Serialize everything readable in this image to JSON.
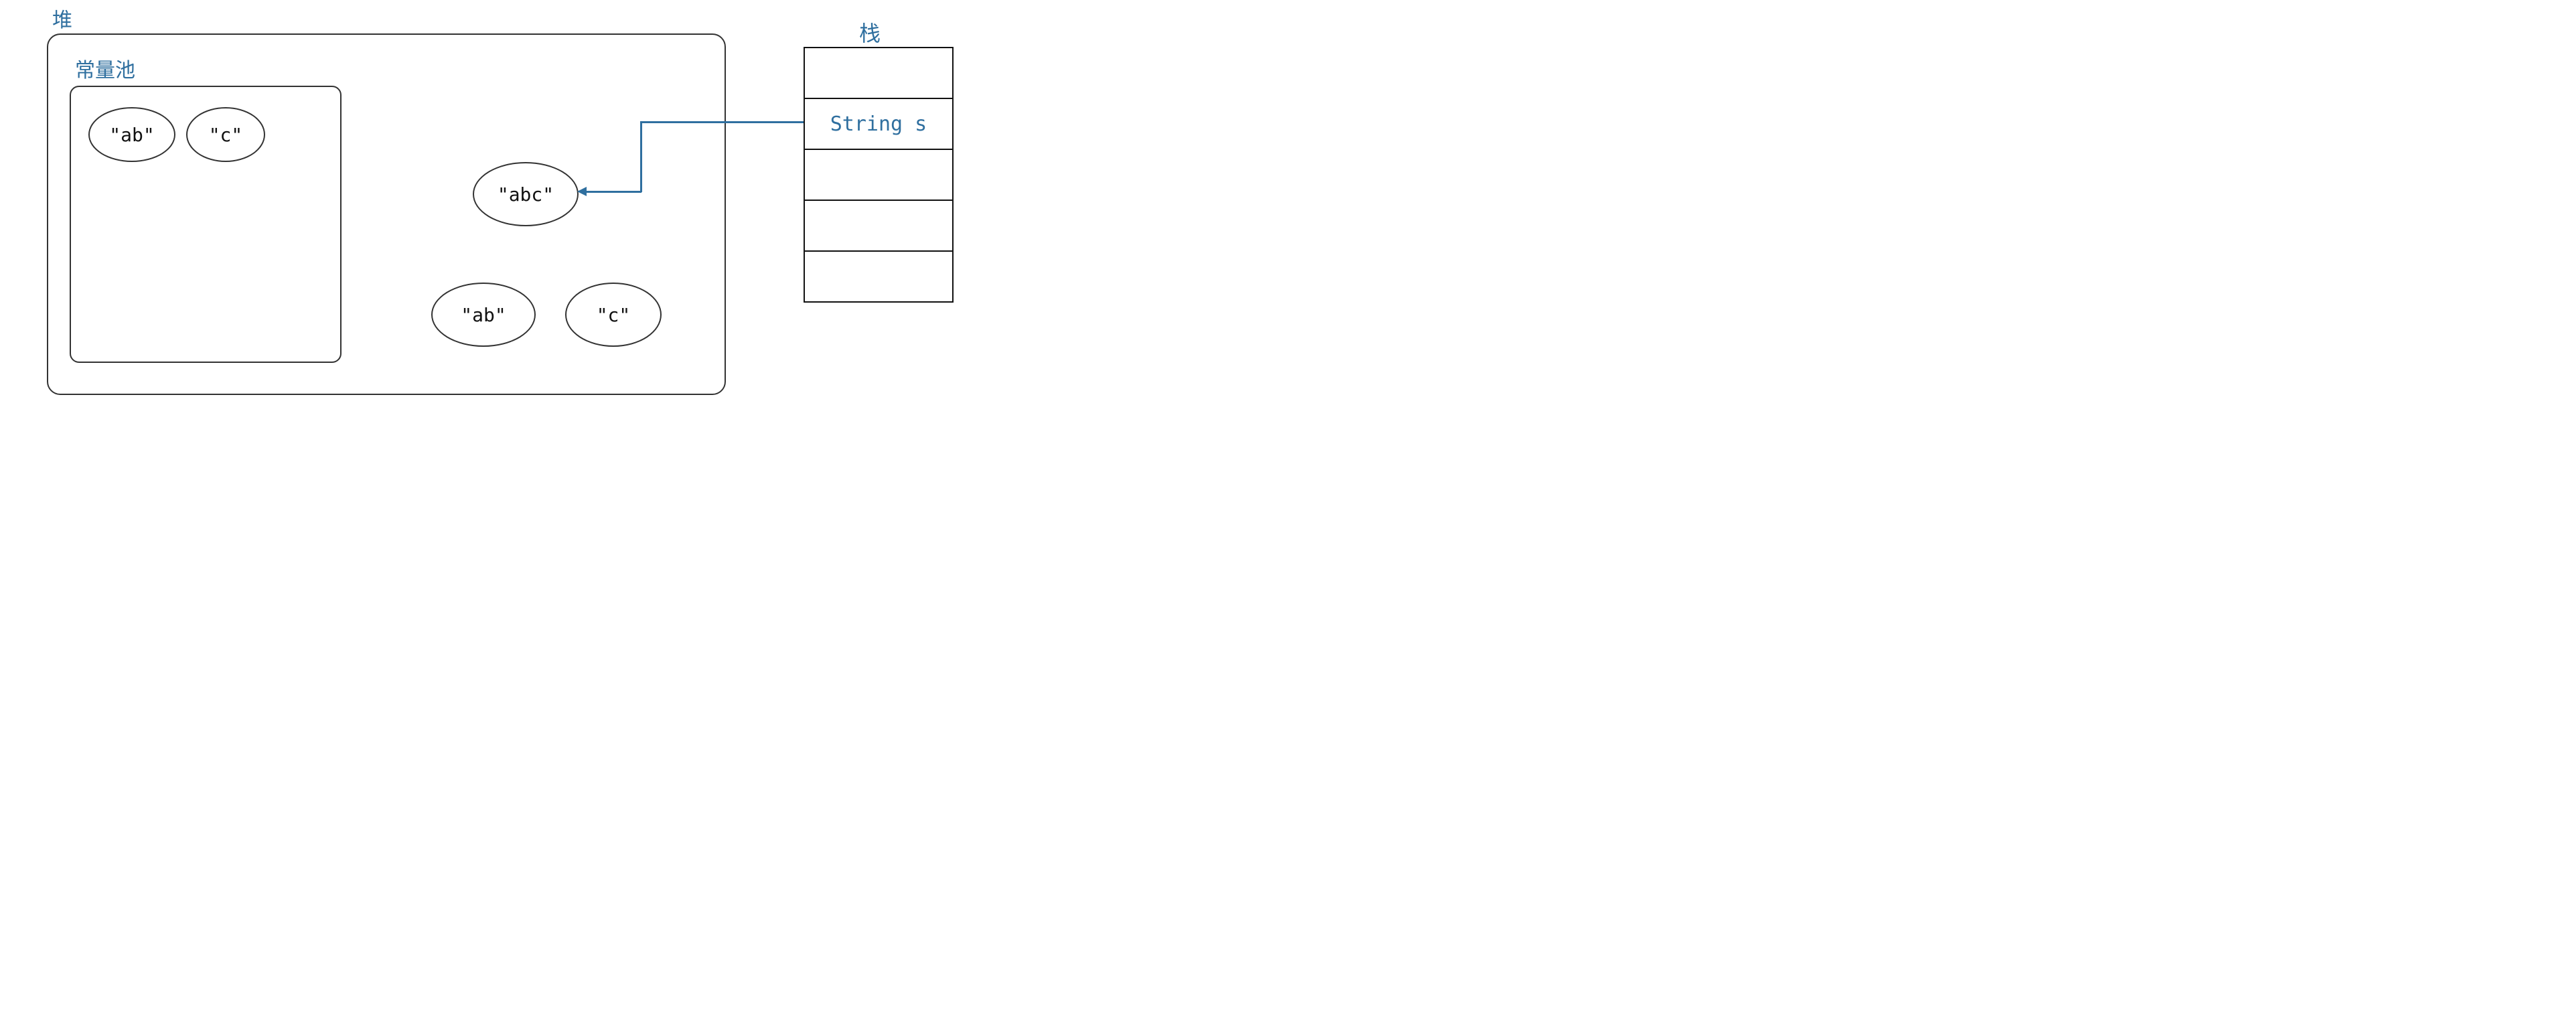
{
  "colors": {
    "label": "#2f6f9f",
    "border": "#333333",
    "arrow": "#2f6f9f"
  },
  "heap": {
    "label": "堆",
    "constant_pool": {
      "label": "常量池",
      "items": [
        {
          "text": "\"ab\""
        },
        {
          "text": "\"c\""
        }
      ]
    },
    "objects": [
      {
        "text": "\"abc\"",
        "role": "string-object-result"
      },
      {
        "text": "\"ab\"",
        "role": "string-object-operand"
      },
      {
        "text": "\"c\"",
        "role": "string-object-operand"
      }
    ]
  },
  "stack": {
    "label": "栈",
    "cells": [
      {
        "text": ""
      },
      {
        "text": "String s"
      },
      {
        "text": ""
      },
      {
        "text": ""
      },
      {
        "text": ""
      }
    ]
  },
  "arrow": {
    "from": "stack.cells.1",
    "to": "heap.objects.0"
  }
}
